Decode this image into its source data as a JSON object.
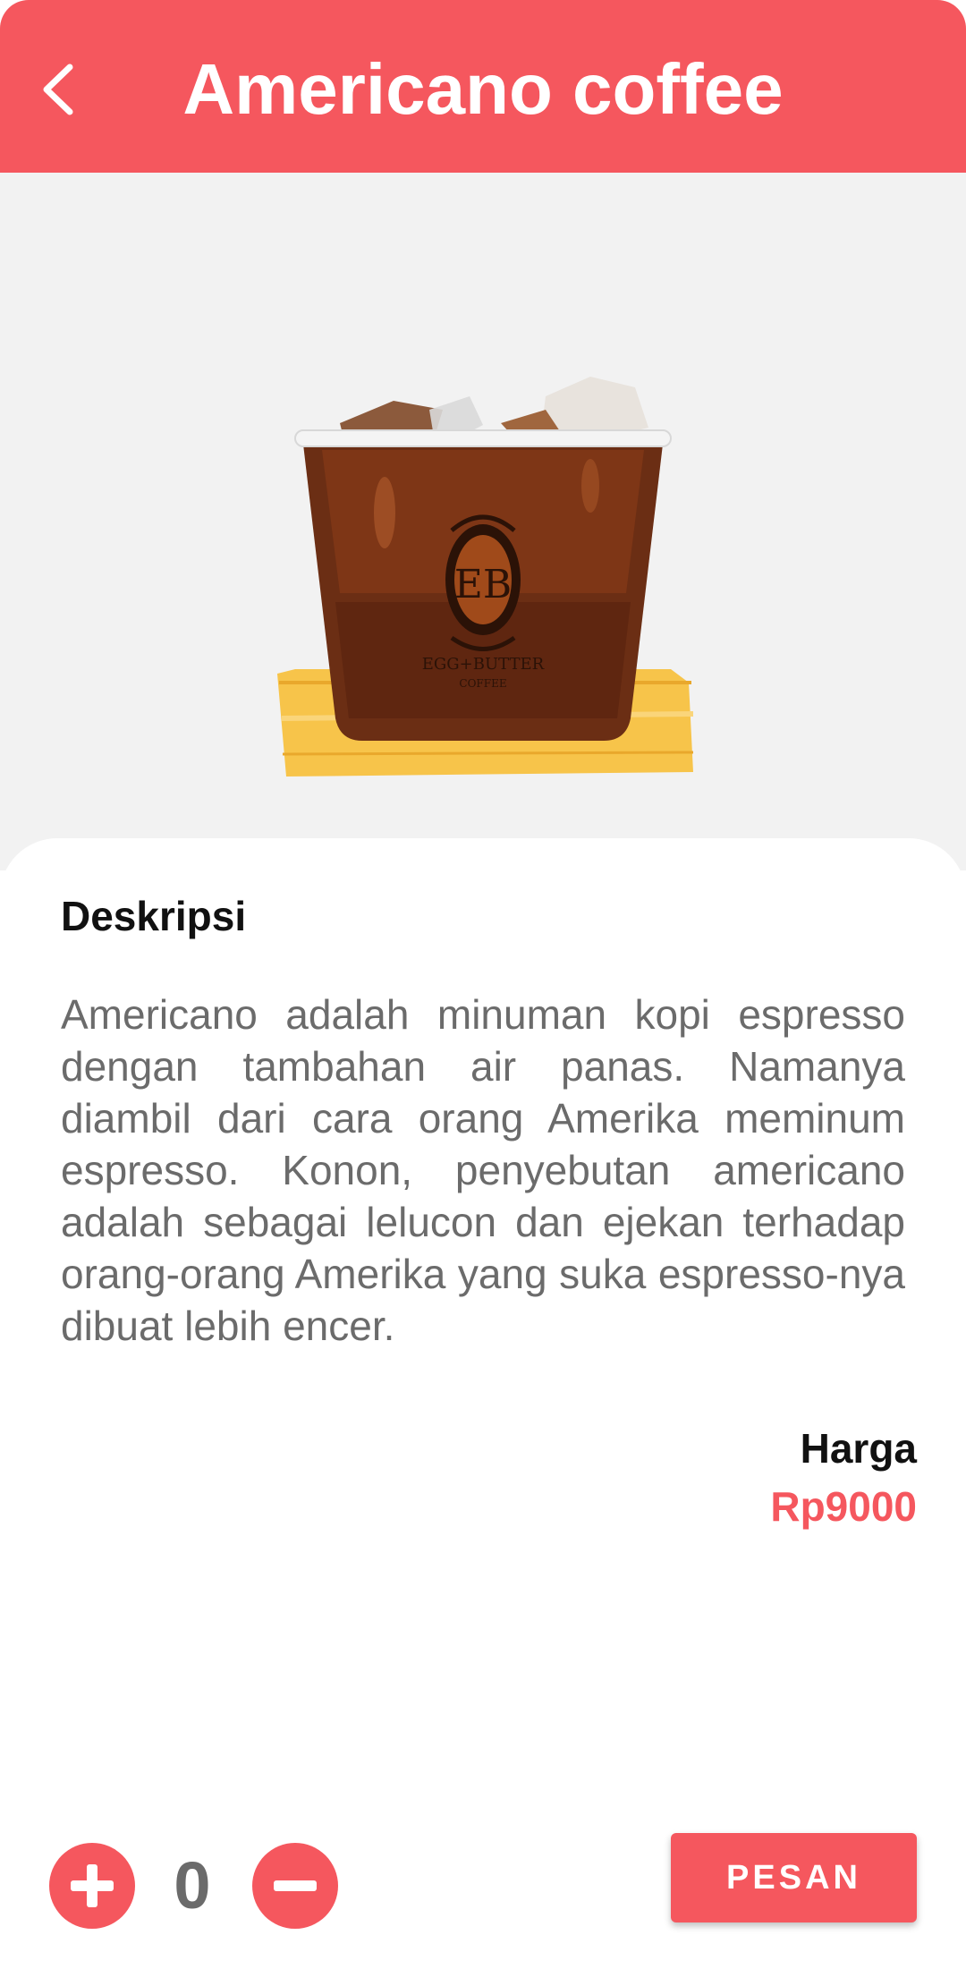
{
  "header": {
    "title": "Americano coffee",
    "back_icon": "chevron-left-icon",
    "background_color": "#F5575E"
  },
  "product_image": {
    "cup_logo_text": "EGG+BUTTER",
    "cup_logo_subtext": "COFFEE"
  },
  "description": {
    "heading": "Deskripsi",
    "text": "Americano adalah minuman kopi espresso dengan tambahan air panas. Namanya diambil dari cara orang Amerika meminum espresso. Konon, penyebutan americano adalah sebagai lelucon dan ejekan terhadap orang-orang Amerika yang suka espresso-nya dibuat lebih encer."
  },
  "price": {
    "label": "Harga",
    "value": "Rp9000",
    "value_color": "#F5575E"
  },
  "controls": {
    "quantity": "0",
    "plus_icon": "plus-icon",
    "minus_icon": "minus-icon",
    "order_label": "PESAN"
  }
}
